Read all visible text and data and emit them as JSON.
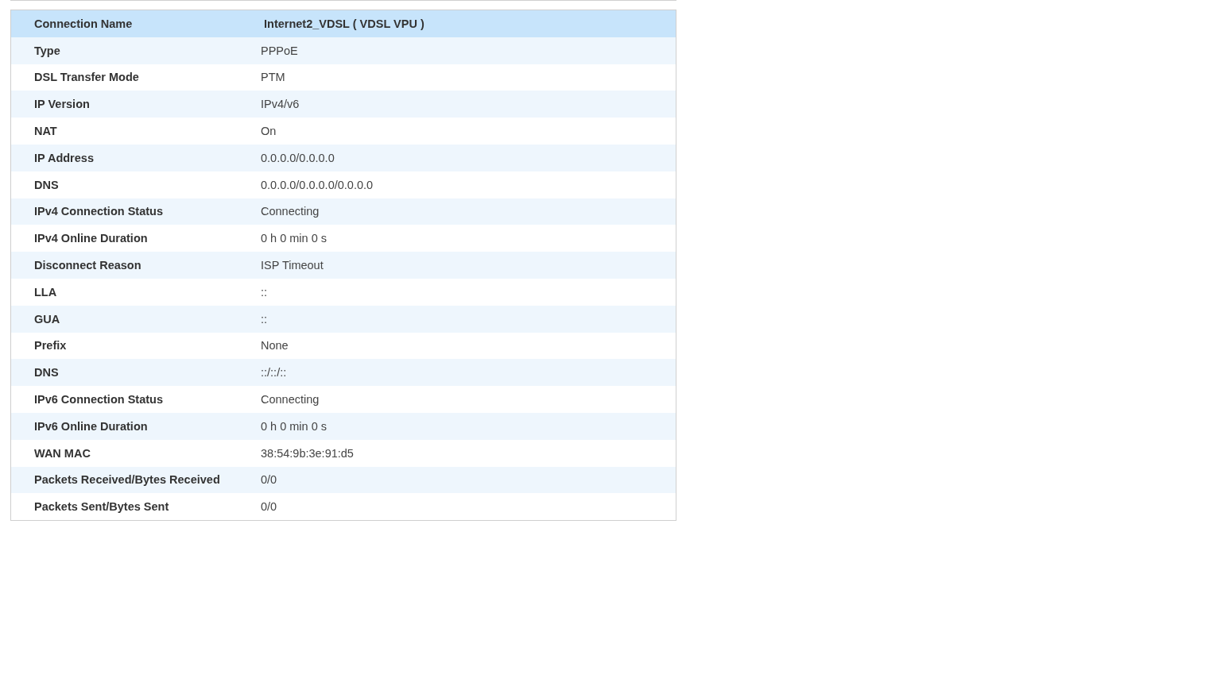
{
  "header": {
    "label": "Connection Name",
    "value": "Internet2_VDSL ( VDSL VPU )"
  },
  "rows": [
    {
      "label": "Type",
      "value": "PPPoE"
    },
    {
      "label": "DSL Transfer Mode",
      "value": "PTM"
    },
    {
      "label": "IP Version",
      "value": "IPv4/v6"
    },
    {
      "label": "NAT",
      "value": "On"
    },
    {
      "label": "IP Address",
      "value": "0.0.0.0/0.0.0.0"
    },
    {
      "label": "DNS",
      "value": "0.0.0.0/0.0.0.0/0.0.0.0"
    },
    {
      "label": "IPv4 Connection Status",
      "value": "Connecting"
    },
    {
      "label": "IPv4 Online Duration",
      "value": "0 h 0 min 0 s"
    },
    {
      "label": "Disconnect Reason",
      "value": "ISP Timeout"
    },
    {
      "label": "LLA",
      "value": "::"
    },
    {
      "label": "GUA",
      "value": "::"
    },
    {
      "label": "Prefix",
      "value": "None"
    },
    {
      "label": "DNS",
      "value": "::/::/::"
    },
    {
      "label": "IPv6 Connection Status",
      "value": "Connecting"
    },
    {
      "label": "IPv6 Online Duration",
      "value": "0 h 0 min 0 s"
    },
    {
      "label": "WAN MAC",
      "value": "38:54:9b:3e:91:d5"
    },
    {
      "label": "Packets Received/Bytes Received",
      "value": "0/0"
    },
    {
      "label": "Packets Sent/Bytes Sent",
      "value": "0/0"
    }
  ]
}
